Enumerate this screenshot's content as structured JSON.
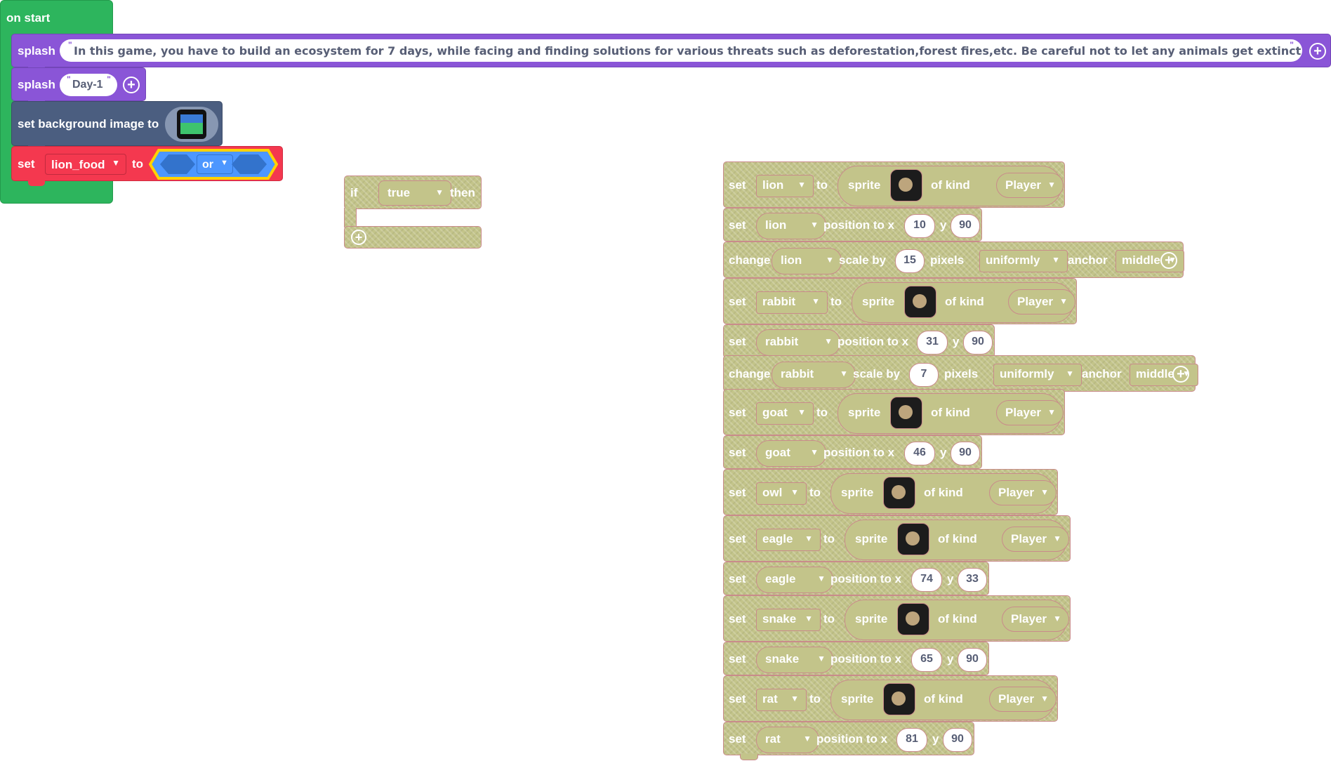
{
  "on_start": {
    "hat_label": "on start",
    "splash1": {
      "label": "splash",
      "text": "In this game, you have to build an ecosystem for 7 days, while facing and finding solutions for various threats such as deforestation,forest fires,etc. Be careful not to let any animals get extinct"
    },
    "splash2": {
      "label": "splash",
      "text": "Day-1"
    },
    "set_bg": {
      "label": "set background image to",
      "image_icon": "landscape-image-icon"
    },
    "set_var": {
      "set_label": "set",
      "variable": "lion_food",
      "to_label": "to",
      "operator": "or"
    }
  },
  "if_block": {
    "if_label": "if",
    "condition": "true",
    "then_label": "then"
  },
  "colors": {
    "hat_green": "#2db55d",
    "looks_purple": "#8a55d7",
    "scene_slate": "#4b5e80",
    "variable_red": "#f4384f",
    "logic_blue": "#4d97ff",
    "hatch": "#c3c48a"
  },
  "sprite_blocks": [
    {
      "type": "set_sprite",
      "set": "set",
      "var": "lion",
      "to": "to",
      "sprite_label": "sprite",
      "icon": "lion-icon",
      "of_kind": "of kind",
      "kind": "Player"
    },
    {
      "type": "position",
      "set": "set",
      "var": "lion",
      "pos_label": "position to x",
      "x": "10",
      "y_label": "y",
      "y": "90"
    },
    {
      "type": "scale",
      "change": "change",
      "var": "lion",
      "scale_label": "scale by",
      "value": "15",
      "pixels": "pixels",
      "mode": "uniformly",
      "anchor_label": "anchor",
      "anchor": "middle"
    },
    {
      "type": "set_sprite",
      "set": "set",
      "var": "rabbit",
      "to": "to",
      "sprite_label": "sprite",
      "icon": "rabbit-icon",
      "of_kind": "of kind",
      "kind": "Player"
    },
    {
      "type": "position",
      "set": "set",
      "var": "rabbit",
      "pos_label": "position to x",
      "x": "31",
      "y_label": "y",
      "y": "90"
    },
    {
      "type": "scale",
      "change": "change",
      "var": "rabbit",
      "scale_label": "scale by",
      "value": "7",
      "pixels": "pixels",
      "mode": "uniformly",
      "anchor_label": "anchor",
      "anchor": "middle"
    },
    {
      "type": "set_sprite",
      "set": "set",
      "var": "goat",
      "to": "to",
      "sprite_label": "sprite",
      "icon": "goat-icon",
      "of_kind": "of kind",
      "kind": "Player"
    },
    {
      "type": "position",
      "set": "set",
      "var": "goat",
      "pos_label": "position to x",
      "x": "46",
      "y_label": "y",
      "y": "90"
    },
    {
      "type": "set_sprite",
      "set": "set",
      "var": "owl",
      "to": "to",
      "sprite_label": "sprite",
      "icon": "owl-icon",
      "of_kind": "of kind",
      "kind": "Player"
    },
    {
      "type": "set_sprite",
      "set": "set",
      "var": "eagle",
      "to": "to",
      "sprite_label": "sprite",
      "icon": "eagle-icon",
      "of_kind": "of kind",
      "kind": "Player"
    },
    {
      "type": "position",
      "set": "set",
      "var": "eagle",
      "pos_label": "position to x",
      "x": "74",
      "y_label": "y",
      "y": "33"
    },
    {
      "type": "set_sprite",
      "set": "set",
      "var": "snake",
      "to": "to",
      "sprite_label": "sprite",
      "icon": "snake-icon",
      "of_kind": "of kind",
      "kind": "Player"
    },
    {
      "type": "position",
      "set": "set",
      "var": "snake",
      "pos_label": "position to x",
      "x": "65",
      "y_label": "y",
      "y": "90"
    },
    {
      "type": "set_sprite",
      "set": "set",
      "var": "rat",
      "to": "to",
      "sprite_label": "sprite",
      "icon": "rat-icon",
      "of_kind": "of kind",
      "kind": "Player"
    },
    {
      "type": "position",
      "set": "set",
      "var": "rat",
      "pos_label": "position to x",
      "x": "81",
      "y_label": "y",
      "y": "90"
    }
  ]
}
